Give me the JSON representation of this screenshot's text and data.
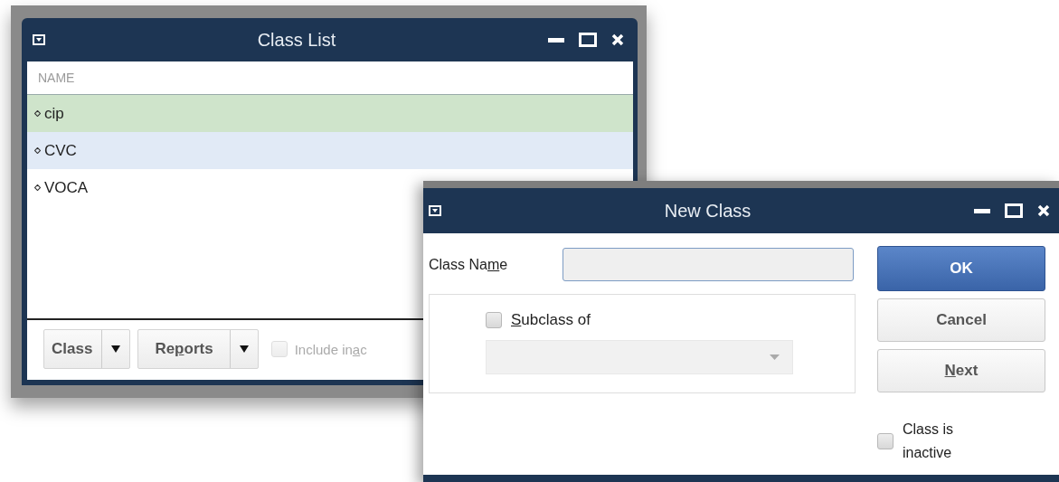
{
  "class_list": {
    "title": "Class List",
    "column": "NAME",
    "rows": [
      {
        "name": "cip",
        "selected": true,
        "hovered": false
      },
      {
        "name": "CVC",
        "selected": false,
        "hovered": true
      },
      {
        "name": "VOCA",
        "selected": false,
        "hovered": false
      }
    ],
    "footer": {
      "class_button": {
        "before": "Class"
      },
      "reports_button": {
        "before": "Re",
        "key": "p",
        "after": "orts"
      },
      "include_inactive": {
        "before": "Include in",
        "key": "a",
        "after": "c",
        "checked": false,
        "disabled": true
      }
    }
  },
  "new_class": {
    "title": "New Class",
    "class_name_label": {
      "before": "Class Na",
      "key": "m",
      "after": "e"
    },
    "subclass": {
      "key": "S",
      "after": "ubclass of",
      "checked": false
    },
    "buttons": [
      {
        "before": "OK",
        "kind": "primary"
      },
      {
        "before": "Cancel",
        "kind": "normal"
      },
      {
        "key": "N",
        "after": "ext",
        "kind": "normal"
      }
    ],
    "inactive": {
      "label": "Class is inactive",
      "checked": false
    }
  }
}
